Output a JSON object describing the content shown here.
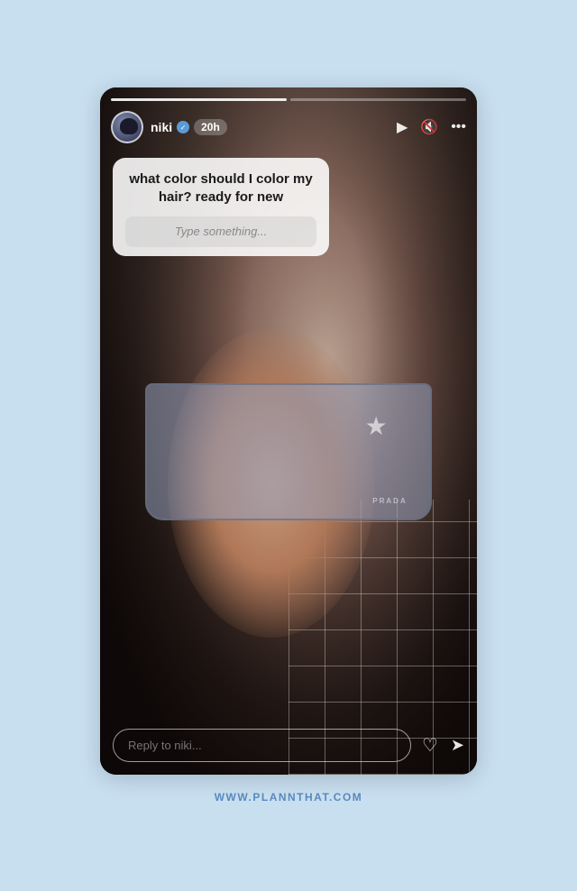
{
  "page": {
    "background_color": "#c8dff0",
    "watermark": "WWW.PLANNTHAT.COM"
  },
  "story": {
    "username": "niki",
    "verified": true,
    "time_ago": "20h",
    "progress_segments": [
      {
        "active": true
      },
      {
        "active": false
      }
    ],
    "question_text": "what color should I color my hair? ready for new",
    "answer_placeholder": "Type something...",
    "reply_placeholder": "Reply to niki...",
    "icons": {
      "play": "▶",
      "mute": "🔇",
      "more": "•••",
      "verified_mark": "✓",
      "heart": "♡",
      "send": "➤"
    }
  }
}
